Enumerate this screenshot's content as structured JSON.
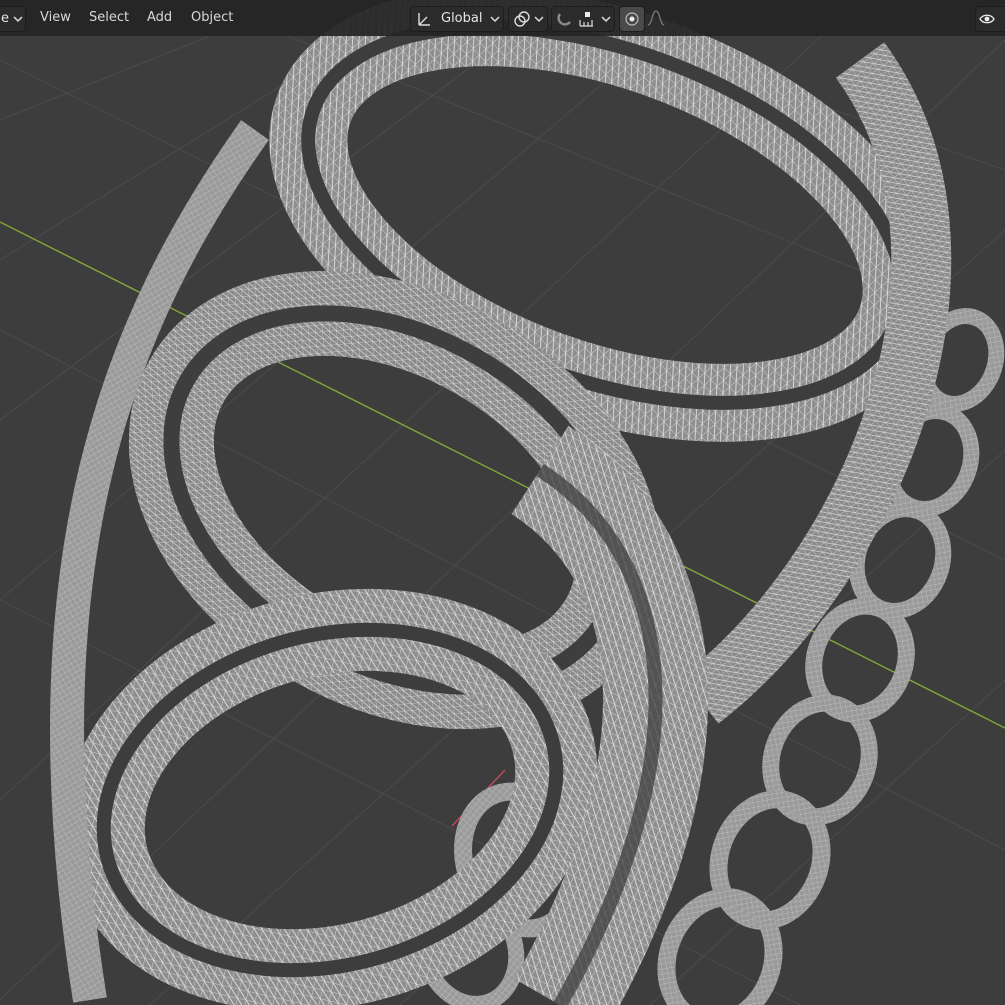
{
  "header": {
    "left_truncated_label": "e",
    "menus": [
      "View",
      "Select",
      "Add",
      "Object"
    ],
    "transform_orientation": "Global"
  },
  "icons": {
    "orientation": "transform-orientation-icon",
    "pivot": "pivot-point-icon",
    "snap": "snap-magnet-icon",
    "snap_increment": "snap-increment-icon",
    "proportional": "proportional-editing-icon",
    "falloff": "falloff-curve-icon",
    "visibility": "visibility-eye-icon"
  },
  "colors": {
    "viewport_bg": "#3d3d3d",
    "grid": "#4a4a4a",
    "mesh_fill": "#8f8f8f",
    "wire": "#e2e2e2",
    "axis_y": "#7fa83a",
    "axis_x": "#c24a5a"
  }
}
